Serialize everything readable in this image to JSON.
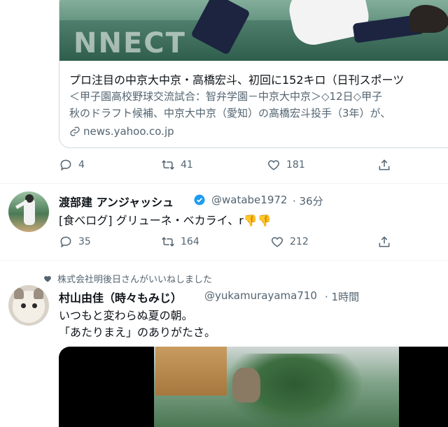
{
  "card": {
    "image_text": "NNECT",
    "title": "プロ注目の中京大中京・高橋宏斗、初回に152キロ（日刊スポーツ",
    "desc_line1": "＜甲子園高校野球交流試合：智弁学園－中京大中京＞◇12日◇甲子",
    "desc_line2": "秋のドラフト候補、中京大中京（愛知）の高橋宏斗投手（3年）が、",
    "domain": "news.yahoo.co.jp"
  },
  "tweet1_actions": {
    "reply": "4",
    "retweet": "41",
    "like": "181"
  },
  "tweet2": {
    "name": "渡部建 アンジャッシュ",
    "handle": "@watabe1972",
    "time": "· 36分",
    "text": "[食べログ] グリューネ・ベカライ、r👎👎",
    "actions": {
      "reply": "35",
      "retweet": "164",
      "like": "212"
    }
  },
  "tweet3": {
    "liked_by": "株式会社明後日さんがいいねしました",
    "name": "村山由佳（時々もみじ）",
    "handle": "@yukamurayama710",
    "time": "· 1時間",
    "text_line1": "いつもと変わらぬ夏の朝。",
    "text_line2": "「あたりまえ」のありがたさ。"
  },
  "colors": {
    "text": "#0f1419",
    "secondary": "#536471",
    "verified": "#1d9bf0",
    "border": "#cfd9de"
  }
}
